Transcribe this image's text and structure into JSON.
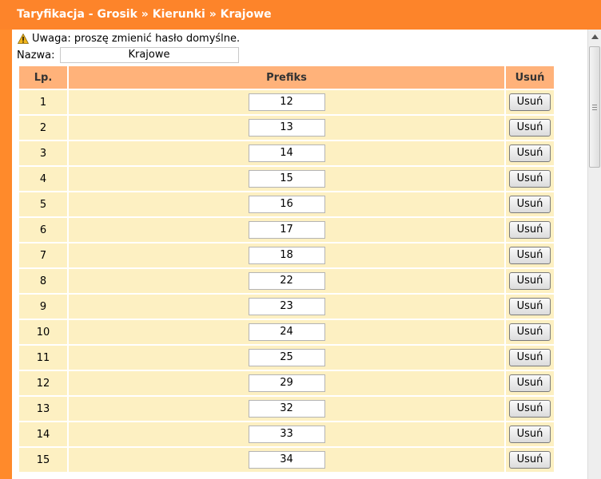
{
  "header": {
    "breadcrumb": [
      "Taryfikacja - Grosik",
      "Kierunki",
      "Krajowe"
    ],
    "separator": "»"
  },
  "warning": {
    "text": "Uwaga: proszę zmienić hasło domyślne."
  },
  "name_field": {
    "label": "Nazwa:",
    "value": "Krajowe"
  },
  "table": {
    "headers": {
      "lp": "Lp.",
      "prefix": "Prefiks",
      "delete": "Usuń"
    },
    "delete_label": "Usuń",
    "rows": [
      {
        "lp": "1",
        "prefix": "12"
      },
      {
        "lp": "2",
        "prefix": "13"
      },
      {
        "lp": "3",
        "prefix": "14"
      },
      {
        "lp": "4",
        "prefix": "15"
      },
      {
        "lp": "5",
        "prefix": "16"
      },
      {
        "lp": "6",
        "prefix": "17"
      },
      {
        "lp": "7",
        "prefix": "18"
      },
      {
        "lp": "8",
        "prefix": "22"
      },
      {
        "lp": "9",
        "prefix": "23"
      },
      {
        "lp": "10",
        "prefix": "24"
      },
      {
        "lp": "11",
        "prefix": "25"
      },
      {
        "lp": "12",
        "prefix": "29"
      },
      {
        "lp": "13",
        "prefix": "32"
      },
      {
        "lp": "14",
        "prefix": "33"
      },
      {
        "lp": "15",
        "prefix": "34"
      }
    ]
  },
  "colors": {
    "brand": "#fd842a",
    "header_cell": "#ffb27a",
    "row": "#fdf0c2"
  }
}
